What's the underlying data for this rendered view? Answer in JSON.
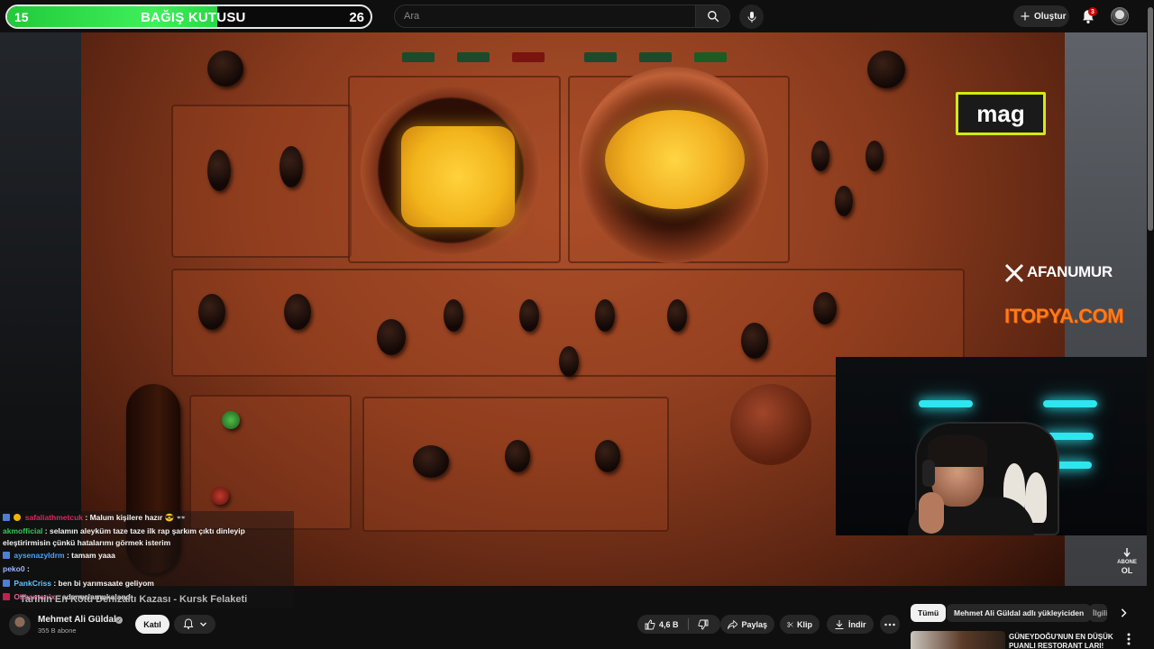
{
  "donation": {
    "label": "BAĞIŞ KUTUSU",
    "current": "15",
    "goal": "26",
    "progress": 0.577,
    "color": "#2fe04a"
  },
  "search": {
    "placeholder": "Ara"
  },
  "header": {
    "create_label": "Oluştur",
    "notification_count": "3"
  },
  "overlay": {
    "mag_label": "mag",
    "x_handle": "AFANUMUR",
    "sponsor": "ITOPYA.COM",
    "subscribe_label_1": "ABONE",
    "subscribe_label_2": "OL"
  },
  "chat": [
    {
      "user": "safaliathmetcuk",
      "message": ": Malum kişilere hazır 😎 👓",
      "user_color": "#e0245e",
      "badge_color": "#4e7fd6"
    },
    {
      "user": "akmofficial",
      "message": ": selamın aleyküm taze taze ilk rap şarkım çıktı dinleyip eleştirirmisin çünkü hatalarımı görmek isterim",
      "user_color": "#34c759",
      "badge_color": ""
    },
    {
      "user": "aysenazyldrm",
      "message": ": tamam yaaa",
      "user_color": "#4aa3ff",
      "badge_color": "#4e7fd6"
    },
    {
      "user": "peko0",
      "message": ":",
      "user_color": "#9fb7ff",
      "badge_color": ""
    },
    {
      "user": "PankCriss",
      "message": ": ben bi yarımsaate geliyom",
      "user_color": "#5ec8ff",
      "badge_color": "#4e7fd6"
    },
    {
      "user": "Oilhamanix",
      "message": ": adamızlarımkalandı",
      "user_color": "#ff6fb0",
      "badge_color": "#e0245e"
    }
  ],
  "video": {
    "title": "Tarihin En Kötü Denizaltı Kazası - Kursk Felaketi"
  },
  "channel": {
    "name": "Mehmet Ali Güldal",
    "subscribers": "355 B abone",
    "join_label": "Katıl"
  },
  "actions": {
    "likes": "4,6 B",
    "share": "Paylaş",
    "clip": "Klip",
    "download": "İndir"
  },
  "chips": {
    "all": "Tümü",
    "uploader": "Mehmet Ali Güldal adlı yükleyiciden",
    "more": "İlgili"
  },
  "recommendation": {
    "title": "GÜNEYDOĞU'NUN EN DÜŞÜK PUANLI RESTORANT LARI!"
  }
}
